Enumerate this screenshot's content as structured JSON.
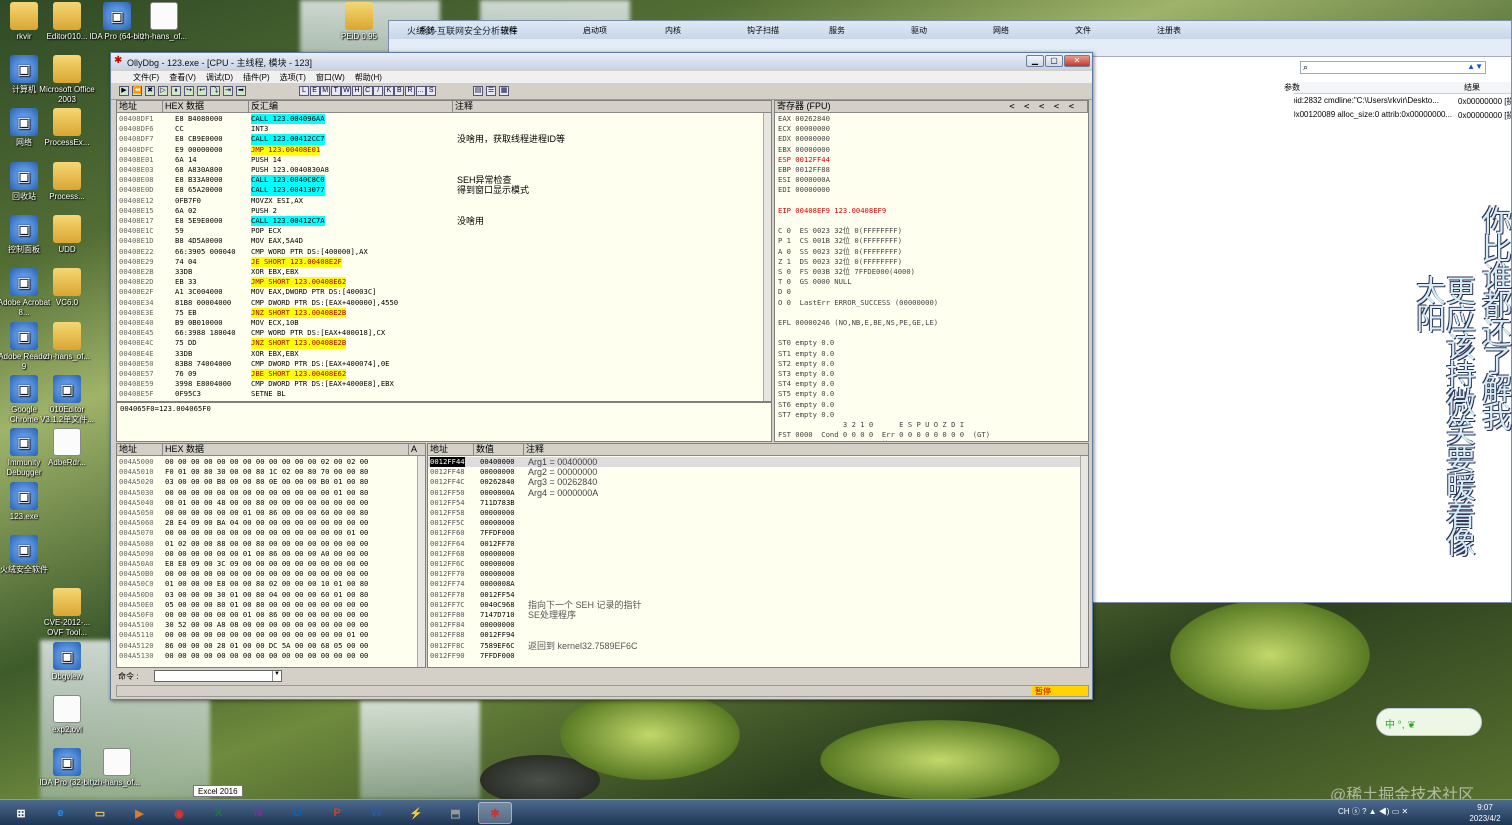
{
  "desktop": {
    "icons": [
      {
        "label": "rkvir",
        "kind": "folder"
      },
      {
        "label": "Editor010...",
        "kind": "folder"
      },
      {
        "label": "IDA Pro (64-bit)",
        "kind": "app"
      },
      {
        "label": "zh-hans_of...",
        "kind": "doc"
      },
      {
        "label": "计算机",
        "kind": "app"
      },
      {
        "label": "Microsoft Office 2003",
        "kind": "folder"
      },
      {
        "label": "网络",
        "kind": "app"
      },
      {
        "label": "ProcessEx...",
        "kind": "folder"
      },
      {
        "label": "回收站",
        "kind": "app"
      },
      {
        "label": "Process...",
        "kind": "folder"
      },
      {
        "label": "控制面板",
        "kind": "app"
      },
      {
        "label": "UDD",
        "kind": "folder"
      },
      {
        "label": "Adobe Acrobat 8...",
        "kind": "app"
      },
      {
        "label": "VC6.0",
        "kind": "folder"
      },
      {
        "label": "Adobe Reader 9",
        "kind": "app"
      },
      {
        "label": "zh-hans_of...",
        "kind": "folder"
      },
      {
        "label": "Google Chrome",
        "kind": "app"
      },
      {
        "label": "010Editor V3.1.2单文件...",
        "kind": "app"
      },
      {
        "label": "Immunity Debugger",
        "kind": "app"
      },
      {
        "label": "AdbeRdr...",
        "kind": "doc"
      },
      {
        "label": "123.exe",
        "kind": "app"
      },
      {
        "label": "火绒安全软件",
        "kind": "app"
      },
      {
        "label": "CVE-2012-... OVF Tool...",
        "kind": "folder"
      },
      {
        "label": "Dbgview",
        "kind": "app"
      },
      {
        "label": "exp2.ovl",
        "kind": "doc"
      },
      {
        "label": "IDA Pro (32-bit)",
        "kind": "app"
      },
      {
        "label": "zh-hans_of...",
        "kind": "doc"
      },
      {
        "label": "PEiD 0.95",
        "kind": "folder"
      }
    ]
  },
  "bgwin": {
    "title": "火绒剑-互联网安全分析软件",
    "tabs": [
      "系统",
      "进程",
      "启动项",
      "内核",
      "钩子扫描",
      "服务",
      "驱动",
      "网络",
      "文件",
      "注册表"
    ],
    "col_param": "参数",
    "col_result": "结果",
    "rows": [
      {
        "param": "parent_pid:2832 cmdline:\"C:\\Users\\rkvir\\Deskto...",
        "result": "0x00000000 [操作成功完成。 ]"
      },
      {
        "param": "access:0x00120089 alloc_size:0 attrib:0x00000000...",
        "result": "0x00000000 [操作成功完成。 ]"
      }
    ]
  },
  "olly": {
    "title": "OllyDbg - 123.exe - [CPU - 主线程, 模块 - 123]",
    "menu": [
      "文件(F)",
      "查看(V)",
      "调试(D)",
      "插件(P)",
      "选项(T)",
      "窗口(W)",
      "帮助(H)"
    ],
    "toolbar": [
      "L",
      "E",
      "M",
      "T",
      "W",
      "H",
      "C",
      "/",
      "K",
      "B",
      "R",
      "...",
      "S"
    ],
    "disasm": {
      "headers": [
        "地址",
        "HEX 数据",
        "反汇编",
        "注释"
      ],
      "rows": [
        {
          "a": "00408DF1",
          "h": "E8 B4080000",
          "d": "CALL 123.004096AA",
          "c": "",
          "t": "call"
        },
        {
          "a": "00408DF6",
          "h": "CC",
          "d": "INT3",
          "c": "",
          "t": ""
        },
        {
          "a": "00408DF7",
          "h": "E8 CB9E0000",
          "d": "CALL 123.00412CC7",
          "c": "没啥用，获取线程进程ID等",
          "t": "call"
        },
        {
          "a": "00408DFC",
          "h": "E9 00000000",
          "d": "JMP 123.00408E01",
          "c": "",
          "t": "jmp"
        },
        {
          "a": "00408E01",
          "h": "6A 14",
          "d": "PUSH 14",
          "c": "",
          "t": ""
        },
        {
          "a": "00408E03",
          "h": "68 A830A800",
          "d": "PUSH 123.0040830A8",
          "c": "",
          "t": ""
        },
        {
          "a": "00408E08",
          "h": "E8 B33A0000",
          "d": "CALL 123.0040C8C0",
          "c": "SEH异常检查",
          "t": "call"
        },
        {
          "a": "00408E0D",
          "h": "E8 65A20000",
          "d": "CALL 123.00413077",
          "c": "得到窗口显示模式",
          "t": "call"
        },
        {
          "a": "00408E12",
          "h": "0FB7F0",
          "d": "MOVZX ESI,AX",
          "c": "",
          "t": ""
        },
        {
          "a": "00408E15",
          "h": "6A 02",
          "d": "PUSH 2",
          "c": "",
          "t": ""
        },
        {
          "a": "00408E17",
          "h": "E8 5E9E0000",
          "d": "CALL 123.00412C7A",
          "c": "没啥用",
          "t": "call"
        },
        {
          "a": "00408E1C",
          "h": "59",
          "d": "POP ECX",
          "c": "",
          "t": ""
        },
        {
          "a": "00408E1D",
          "h": "B8 4D5A0000",
          "d": "MOV EAX,5A4D",
          "c": "",
          "t": ""
        },
        {
          "a": "00408E22",
          "h": "66:3905 000040",
          "d": "CMP WORD PTR DS:[400000],AX",
          "c": "",
          "t": ""
        },
        {
          "a": "00408E29",
          "h": "74 04",
          "d": "JE SHORT 123.00408E2F",
          "c": "",
          "t": "jmp"
        },
        {
          "a": "00408E2B",
          "h": "33DB",
          "d": "XOR EBX,EBX",
          "c": "",
          "t": ""
        },
        {
          "a": "00408E2D",
          "h": "EB 33",
          "d": "JMP SHORT 123.00408E62",
          "c": "",
          "t": "jmp"
        },
        {
          "a": "00408E2F",
          "h": "A1 3C004000",
          "d": "MOV EAX,DWORD PTR DS:[40003C]",
          "c": "",
          "t": ""
        },
        {
          "a": "00408E34",
          "h": "81B8 00004000",
          "d": "CMP DWORD PTR DS:[EAX+400000],4550",
          "c": "",
          "t": ""
        },
        {
          "a": "00408E3E",
          "h": "75 EB",
          "d": "JNZ SHORT 123.00408E2B",
          "c": "",
          "t": "jmp"
        },
        {
          "a": "00408E40",
          "h": "B9 0B010000",
          "d": "MOV ECX,10B",
          "c": "",
          "t": ""
        },
        {
          "a": "00408E45",
          "h": "66:3988 180040",
          "d": "CMP WORD PTR DS:[EAX+400018],CX",
          "c": "",
          "t": ""
        },
        {
          "a": "00408E4C",
          "h": "75 DD",
          "d": "JNZ SHORT 123.00408E2B",
          "c": "",
          "t": "jmp"
        },
        {
          "a": "00408E4E",
          "h": "33DB",
          "d": "XOR EBX,EBX",
          "c": "",
          "t": ""
        },
        {
          "a": "00408E50",
          "h": "83B8 74004000",
          "d": "CMP DWORD PTR DS:[EAX+400074],0E",
          "c": "",
          "t": ""
        },
        {
          "a": "00408E57",
          "h": "76 09",
          "d": "JBE SHORT 123.00408E62",
          "c": "",
          "t": "jmp"
        },
        {
          "a": "00408E59",
          "h": "3998 E8004000",
          "d": "CMP DWORD PTR DS:[EAX+4000E8],EBX",
          "c": "",
          "t": ""
        },
        {
          "a": "00408E5F",
          "h": "0F95C3",
          "d": "SETNE BL",
          "c": "",
          "t": ""
        }
      ],
      "info": "004065F0=123.004065F0"
    },
    "regs": {
      "header": "寄存器 (FPU)",
      "lines": [
        "EAX 00262840",
        "ECX 00000000",
        "EDX 00000000",
        "EBX 00000000",
        "ESP 0012FF44",
        "EBP 0012FF88",
        "ESI 0000000A",
        "EDI 00000000",
        "",
        "EIP 00408EF9 123.00408EF9",
        "",
        "C 0  ES 0023 32位 0(FFFFFFFF)",
        "P 1  CS 001B 32位 0(FFFFFFFF)",
        "A 0  SS 0023 32位 0(FFFFFFFF)",
        "Z 1  DS 0023 32位 0(FFFFFFFF)",
        "S 0  FS 003B 32位 7FFDE000(4000)",
        "T 0  GS 0000 NULL",
        "D 0",
        "O 0  LastErr ERROR_SUCCESS (00000000)",
        "",
        "EFL 00000246 (NO,NB,E,BE,NS,PE,GE,LE)",
        "",
        "ST0 empty 0.0",
        "ST1 empty 0.0",
        "ST2 empty 0.0",
        "ST3 empty 0.0",
        "ST4 empty 0.0",
        "ST5 empty 0.0",
        "ST6 empty 0.0",
        "ST7 empty 0.0",
        "               3 2 1 0      E S P U O Z D I",
        "FST 0000  Cond 0 0 0 0  Err 0 0 0 0 0 0 0 0  (GT)",
        "FCW 027F  Prec NEAR,53  掩码    1 1 1 1 1 1"
      ]
    },
    "dump": {
      "headers": [
        "地址",
        "HEX 数据",
        "A"
      ],
      "rows": [
        {
          "a": "004A5000",
          "h": "00 00 00 00 00 00 00 00 00 00 00 00 02 00 02 00"
        },
        {
          "a": "004A5010",
          "h": "F0 01 00 80 30 00 00 80 1C 02 00 80 70 00 00 80"
        },
        {
          "a": "004A5020",
          "h": "03 00 00 00 B0 00 00 80 0E 00 00 00 B0 01 00 80"
        },
        {
          "a": "004A5030",
          "h": "00 00 00 00 00 00 00 00 00 00 00 00 00 01 00 80"
        },
        {
          "a": "004A5040",
          "h": "00 01 00 00 48 00 00 80 00 00 00 00 00 00 00 00"
        },
        {
          "a": "004A5050",
          "h": "00 00 00 00 00 00 01 00 86 00 00 00 60 00 00 80"
        },
        {
          "a": "004A5060",
          "h": "28 E4 09 00 BA 04 00 00 00 00 00 00 00 00 00 00"
        },
        {
          "a": "004A5070",
          "h": "00 00 00 00 00 00 00 00 00 00 00 00 00 00 01 00"
        },
        {
          "a": "004A5080",
          "h": "01 02 00 00 88 00 00 80 00 00 00 00 00 00 00 00"
        },
        {
          "a": "004A5090",
          "h": "00 00 00 00 00 00 01 00 86 00 00 00 A0 00 00 00"
        },
        {
          "a": "004A50A0",
          "h": "E8 E8 09 00 3C 09 00 00 00 00 00 00 00 00 00 00"
        },
        {
          "a": "004A50B0",
          "h": "00 00 00 00 00 00 00 00 00 00 00 00 00 00 00 00"
        },
        {
          "a": "004A50C0",
          "h": "01 00 00 00 E8 00 00 80 02 00 00 00 10 01 00 80"
        },
        {
          "a": "004A50D0",
          "h": "03 00 00 00 30 01 00 80 04 00 00 00 60 01 00 80"
        },
        {
          "a": "004A50E0",
          "h": "05 00 00 00 80 01 00 80 00 00 00 00 00 00 00 00"
        },
        {
          "a": "004A50F0",
          "h": "00 00 00 00 00 00 01 00 86 00 00 00 00 00 00 00"
        },
        {
          "a": "004A5100",
          "h": "30 52 00 00 A8 08 00 00 00 00 00 00 00 00 00 00"
        },
        {
          "a": "004A5110",
          "h": "00 00 00 00 00 00 00 00 00 00 00 00 00 00 01 00"
        },
        {
          "a": "004A5120",
          "h": "86 00 00 00 28 01 00 00 DC 5A 00 00 68 05 00 00"
        },
        {
          "a": "004A5130",
          "h": "00 00 00 00 00 00 00 00 00 00 00 00 00 00 00 00"
        }
      ]
    },
    "stack": {
      "headers": [
        "地址",
        "数值",
        "注释"
      ],
      "rows": [
        {
          "a": "0012FF44",
          "v": "00400000",
          "c": "Arg1 = 00400000"
        },
        {
          "a": "0012FF48",
          "v": "00000000",
          "c": "Arg2 = 00000000"
        },
        {
          "a": "0012FF4C",
          "v": "00262840",
          "c": "Arg3 = 00262840"
        },
        {
          "a": "0012FF50",
          "v": "0000000A",
          "c": "Arg4 = 0000000A"
        },
        {
          "a": "0012FF54",
          "v": "711D783B",
          "c": ""
        },
        {
          "a": "0012FF58",
          "v": "00000000",
          "c": ""
        },
        {
          "a": "0012FF5C",
          "v": "00000000",
          "c": ""
        },
        {
          "a": "0012FF60",
          "v": "7FFDF000",
          "c": ""
        },
        {
          "a": "0012FF64",
          "v": "0012FF70",
          "c": ""
        },
        {
          "a": "0012FF68",
          "v": "00000000",
          "c": ""
        },
        {
          "a": "0012FF6C",
          "v": "00000000",
          "c": ""
        },
        {
          "a": "0012FF70",
          "v": "00000000",
          "c": ""
        },
        {
          "a": "0012FF74",
          "v": "0000008A",
          "c": ""
        },
        {
          "a": "0012FF78",
          "v": "0012FF54",
          "c": ""
        },
        {
          "a": "0012FF7C",
          "v": "0040C968",
          "c": "指向下一个 SEH 记录的指针"
        },
        {
          "a": "0012FF80",
          "v": "7147D710",
          "c": "SE处理程序"
        },
        {
          "a": "0012FF84",
          "v": "00000000",
          "c": ""
        },
        {
          "a": "0012FF88",
          "v": "0012FF94",
          "c": ""
        },
        {
          "a": "0012FF8C",
          "v": "7589EF6C",
          "c": "返回到 kernel32.7589EF6C"
        },
        {
          "a": "0012FF90",
          "v": "7FFDF000",
          "c": ""
        }
      ]
    },
    "command_label": "命令 :",
    "status": "暂停"
  },
  "quote": {
    "col1": "你比谁都还了解我",
    "col2": "更应该持微笑要暖着像太阳"
  },
  "ime": "中 °, ❦",
  "watermark": "@稀土掘金技术社区",
  "taskbar": {
    "items": [
      "⊞",
      "e",
      "▭",
      "▶",
      "◉",
      "X",
      "N",
      "O",
      "P",
      "W",
      "⚡",
      "⬒",
      "✱"
    ],
    "tooltip": "Excel 2016",
    "tray": "CH ⓢ ? ▲ ◀) ▭ ✕",
    "time": "9:07",
    "date": "2023/4/2"
  },
  "colors": {
    "call_bg": "#00ffff",
    "jmp_bg": "#ffff00",
    "pane_bg": "#fffff0",
    "status": "#ffd400"
  }
}
